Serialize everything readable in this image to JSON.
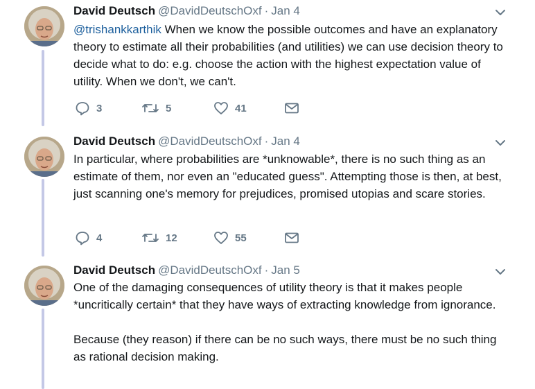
{
  "tweets": [
    {
      "name": "David Deutsch",
      "handle": "@DavidDeutschOxf",
      "dot": "·",
      "date": "Jan 4",
      "mention": "@trishankkarthik",
      "text": " When we know the possible outcomes and have an explanatory theory to estimate all their probabilities (and utilities) we can use decision theory to decide what to do: e.g. choose the action with the highest expectation value of utility. When we don't, we can't.",
      "replies": "3",
      "retweets": "5",
      "likes": "41"
    },
    {
      "name": "David Deutsch",
      "handle": "@DavidDeutschOxf",
      "dot": "·",
      "date": "Jan 4",
      "text": "In particular, where probabilities are *unknowable*, there is no such thing as an estimate of them, nor even an \"educated guess\". Attempting those is then, at best, just scanning one's memory for prejudices, promised utopias and scare stories.",
      "replies": "4",
      "retweets": "12",
      "likes": "55"
    },
    {
      "name": "David Deutsch",
      "handle": "@DavidDeutschOxf",
      "dot": "·",
      "date": "Jan 5",
      "text": "One of the damaging consequences of utility theory is that it makes people *uncritically certain* that they have ways of extracting knowledge from ignorance.",
      "text2": "Because (they reason) if there can be no such ways, there must be no such thing as rational decision making."
    }
  ],
  "icons": {
    "reply": "reply-icon",
    "retweet": "retweet-icon",
    "like": "heart-icon",
    "dm": "envelope-icon",
    "menu": "chevron-down-icon"
  },
  "colors": {
    "thread_line": "#c4c8e6",
    "mention": "#1b5e9c",
    "meta": "#657786"
  }
}
